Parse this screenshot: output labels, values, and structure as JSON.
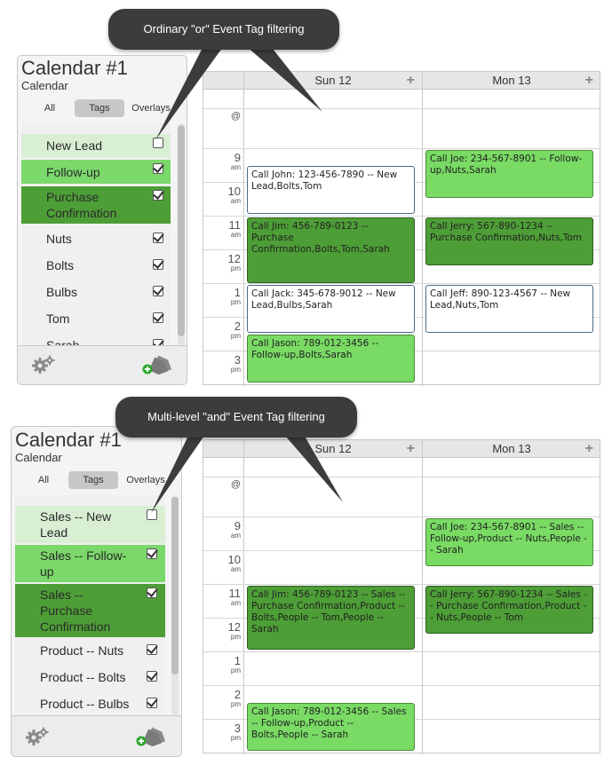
{
  "colors": {
    "light_green": "#d9efd4",
    "mid_green": "#7bd86a",
    "dark_green": "#4d9e36",
    "callout_bg": "#3c3c3c"
  },
  "panel1": {
    "callout": "Ordinary \"or\" Event Tag filtering",
    "sidebar": {
      "title": "Calendar #1",
      "subtitle": "Calendar",
      "tabs": [
        {
          "label": "All"
        },
        {
          "label": "Tags"
        },
        {
          "label": "Overlays"
        }
      ],
      "tags": [
        {
          "label": "New Lead",
          "checked": false
        },
        {
          "label": "Follow-up",
          "checked": true
        },
        {
          "label": "Purchase\nConfirmation",
          "checked": true
        },
        {
          "label": "Nuts",
          "checked": true
        },
        {
          "label": "Bolts",
          "checked": true
        },
        {
          "label": "Bulbs",
          "checked": true
        },
        {
          "label": "Tom",
          "checked": true
        },
        {
          "label": "Sarah",
          "checked": true
        }
      ],
      "footer_icons": [
        "gear-icon",
        "add-tag-icon"
      ]
    },
    "grid": {
      "days": [
        {
          "label": "Sun 12",
          "add": "+"
        },
        {
          "label": "Mon 13",
          "add": "+"
        }
      ],
      "allday_label": "@",
      "hours": [
        {
          "hour": "9",
          "ampm": "am"
        },
        {
          "hour": "10",
          "ampm": "am"
        },
        {
          "hour": "11",
          "ampm": "am"
        },
        {
          "hour": "12",
          "ampm": "pm"
        },
        {
          "hour": "1",
          "ampm": "pm"
        },
        {
          "hour": "2",
          "ampm": "pm"
        },
        {
          "hour": "3",
          "ampm": "pm"
        }
      ],
      "events": [
        {
          "text": "Call John: 123-456-7890 -- New Lead,Bolts,Tom"
        },
        {
          "text": "Call Jim: 456-789-0123 -- Purchase Confirmation,Bolts,Tom,Sarah"
        },
        {
          "text": "Call Jack: 345-678-9012 -- New Lead,Bulbs,Sarah"
        },
        {
          "text": "Call Jason: 789-012-3456 -- Follow-up,Bolts,Sarah"
        },
        {
          "text": "Call Joe: 234-567-8901 -- Follow-up,Nuts,Sarah"
        },
        {
          "text": "Call Jerry: 567-890-1234 -- Purchase Confirmation,Nuts,Tom"
        },
        {
          "text": "Call Jeff: 890-123-4567 -- New Lead,Nuts,Tom"
        }
      ]
    }
  },
  "panel2": {
    "callout": "Multi-level \"and\" Event Tag filtering",
    "sidebar": {
      "title": "Calendar #1",
      "subtitle": "Calendar",
      "tabs": [
        {
          "label": "All"
        },
        {
          "label": "Tags"
        },
        {
          "label": "Overlays"
        }
      ],
      "tags": [
        {
          "label": "Sales -- New\nLead",
          "checked": false
        },
        {
          "label": "Sales -- Follow-\nup",
          "checked": true
        },
        {
          "label": "Sales --\nPurchase\nConfirmation",
          "checked": true
        },
        {
          "label": "Product -- Nuts",
          "checked": true
        },
        {
          "label": "Product -- Bolts",
          "checked": true
        },
        {
          "label": "Product -- Bulbs",
          "checked": true
        }
      ],
      "footer_icons": [
        "gear-icon",
        "add-tag-icon"
      ]
    },
    "grid": {
      "days": [
        {
          "label": "Sun 12",
          "add": "+"
        },
        {
          "label": "Mon 13",
          "add": "+"
        }
      ],
      "allday_label": "@",
      "hours": [
        {
          "hour": "9",
          "ampm": "am"
        },
        {
          "hour": "10",
          "ampm": "am"
        },
        {
          "hour": "11",
          "ampm": "am"
        },
        {
          "hour": "12",
          "ampm": "pm"
        },
        {
          "hour": "1",
          "ampm": "pm"
        },
        {
          "hour": "2",
          "ampm": "pm"
        },
        {
          "hour": "3",
          "ampm": "pm"
        }
      ],
      "events": [
        {
          "text": "Call Jim: 456-789-0123 -- Sales -- Purchase Confirmation,Product -- Bolts,People -- Tom,People -- Sarah"
        },
        {
          "text": "Call Jason: 789-012-3456 -- Sales -- Follow-up,Product -- Bolts,People -- Sarah"
        },
        {
          "text": "Call Joe: 234-567-8901 -- Sales -- Follow-up,Product -- Nuts,People -- Sarah"
        },
        {
          "text": "Call Jerry: 567-890-1234 -- Sales -- Purchase Confirmation,Product -- Nuts,People -- Tom"
        }
      ]
    }
  }
}
